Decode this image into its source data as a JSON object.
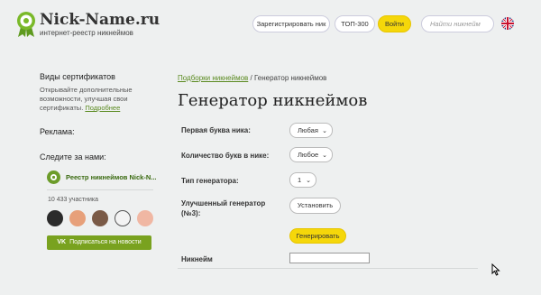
{
  "brand": {
    "name": "Nick-Name.ru",
    "tagline": "интернет-реестр никнеймов",
    "accent": "#7ab929"
  },
  "header": {
    "register": "Зарегистрировать ник",
    "top": "ТОП-300",
    "login": "Войти",
    "search_placeholder": "Найти никнейм",
    "lang_icon": "uk-flag-icon"
  },
  "sidebar": {
    "cert_title": "Виды сертификатов",
    "cert_text": "Открывайте дополнительные возможности, улучшая свои сертификаты.",
    "cert_link": "Подробнее",
    "ads": "Реклама:",
    "follow": "Следите за нами:",
    "group_name": "Реестр никнеймов Nick-N...",
    "members": "10 433 участника",
    "subscribe": "Подписаться на новости"
  },
  "breadcrumb": {
    "link": "Подборки никнеймов",
    "sep": " / ",
    "current": "Генератор никнеймов"
  },
  "page_title": "Генератор никнеймов",
  "form": {
    "first_letter_label": "Первая буква ника:",
    "first_letter_value": "Любая",
    "letters_count_label": "Количество букв в нике:",
    "letters_count_value": "Любое",
    "generator_type_label": "Тип генератора:",
    "generator_type_value": "1",
    "improved_label": "Улучшенный генератор (№3):",
    "install": "Установить",
    "generate": "Генерировать",
    "nick_label": "Никнейм",
    "nick_value": ""
  }
}
